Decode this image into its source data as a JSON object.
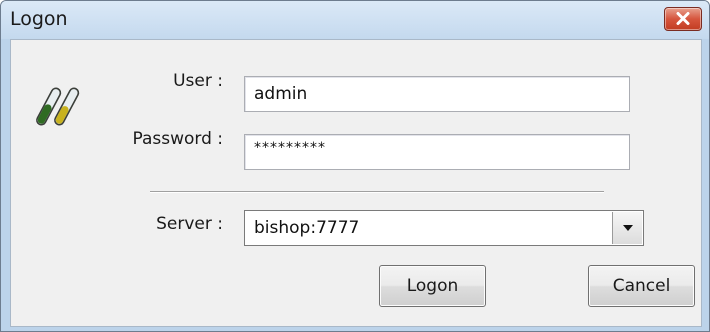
{
  "window": {
    "title": "Logon",
    "close_icon": "close-icon"
  },
  "form": {
    "user_label": "User :",
    "user_value": "admin",
    "password_label": "Password :",
    "password_value": "*********",
    "server_label": "Server :",
    "server_value": "bishop:7777"
  },
  "buttons": {
    "logon": "Logon",
    "cancel": "Cancel"
  },
  "icons": {
    "app": "test-tubes-icon",
    "dropdown": "chevron-down-icon"
  },
  "colors": {
    "titlebar": "#c4d9ee",
    "close_button": "#c23c22",
    "dialog_background": "#f0f0f0"
  }
}
